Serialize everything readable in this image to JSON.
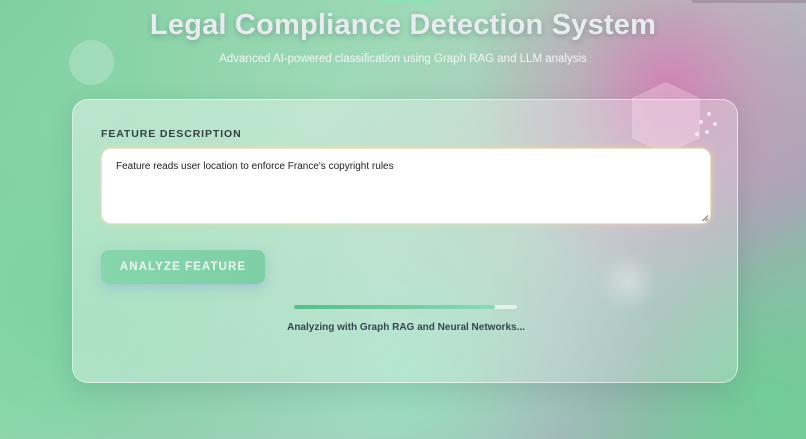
{
  "header": {
    "title": "Legal Compliance Detection System",
    "subtitle": "Advanced AI-powered classification using Graph RAG and LLM analysis"
  },
  "form": {
    "label": "FEATURE DESCRIPTION",
    "description_value": "Feature reads user location to enforce France's copyright rules",
    "analyze_button_label": "ANALYZE FEATURE"
  },
  "progress": {
    "fraction": 0.9,
    "status_text": "Analyzing with Graph RAG and Neural Networks..."
  },
  "colors": {
    "accent": "#7ecea6",
    "progress": "#55bf89",
    "title": "#e7ecef"
  }
}
